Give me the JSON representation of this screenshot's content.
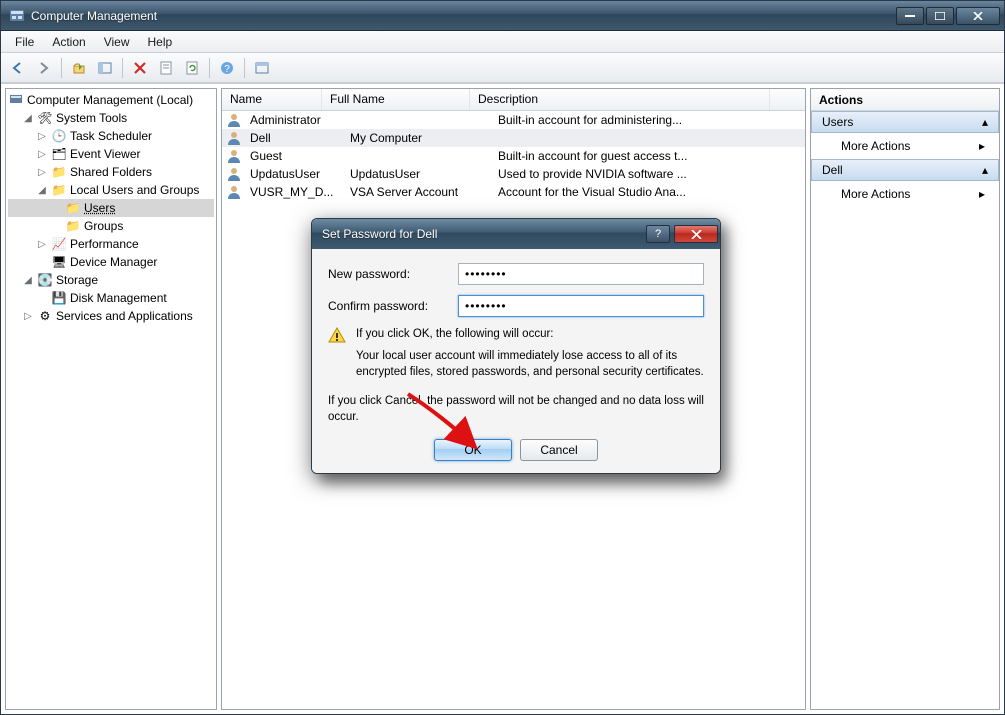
{
  "window_title": "Computer Management",
  "menubar": [
    "File",
    "Action",
    "View",
    "Help"
  ],
  "tree": {
    "root": "Computer Management (Local)",
    "system_tools": "System Tools",
    "task_scheduler": "Task Scheduler",
    "event_viewer": "Event Viewer",
    "shared_folders": "Shared Folders",
    "local_users": "Local Users and Groups",
    "users": "Users",
    "groups": "Groups",
    "performance": "Performance",
    "device_manager": "Device Manager",
    "storage": "Storage",
    "disk_management": "Disk Management",
    "services": "Services and Applications"
  },
  "list": {
    "cols": {
      "name": "Name",
      "full": "Full Name",
      "desc": "Description"
    },
    "rows": [
      {
        "name": "Administrator",
        "full": "",
        "desc": "Built-in account for administering..."
      },
      {
        "name": "Dell",
        "full": "My Computer",
        "desc": ""
      },
      {
        "name": "Guest",
        "full": "",
        "desc": "Built-in account for guest access t..."
      },
      {
        "name": "UpdatusUser",
        "full": "UpdatusUser",
        "desc": "Used to provide NVIDIA software ..."
      },
      {
        "name": "VUSR_MY_D...",
        "full": "VSA Server Account",
        "desc": "Account for the Visual Studio Ana..."
      }
    ]
  },
  "actions": {
    "header": "Actions",
    "grp1": "Users",
    "item1": "More Actions",
    "grp2": "Dell",
    "item2": "More Actions"
  },
  "dialog": {
    "title": "Set Password for Dell",
    "new_label": "New password:",
    "confirm_label": "Confirm password:",
    "new_val": "••••••••",
    "confirm_val": "••••••••",
    "warn_head": "If you click OK, the following will occur:",
    "warn_body": "Your local user account will immediately lose access to all of its encrypted files, stored passwords, and personal security certificates.",
    "cancel_text": "If you click Cancel, the password will not be changed and no data loss will occur.",
    "ok": "OK",
    "cancel": "Cancel"
  }
}
